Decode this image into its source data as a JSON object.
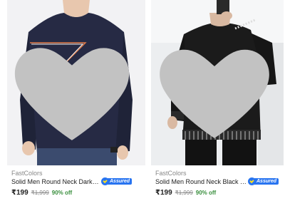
{
  "products": [
    {
      "brand": "FastColors",
      "title": "Solid Men Round Neck Dark Blue T-Shirt",
      "assured_label": "Assured",
      "price": "₹199",
      "mrp": "₹1,999",
      "discount": "90% off",
      "image_icon": "navy-tshirt-image",
      "wishlist_icon": "heart-icon"
    },
    {
      "brand": "FastColors",
      "title": "Solid Men Round Neck Black T-Shirt",
      "assured_label": "Assured",
      "price": "₹199",
      "mrp": "₹1,999",
      "discount": "90% off",
      "image_icon": "black-tshirt-image",
      "wishlist_icon": "heart-icon"
    }
  ],
  "colors": {
    "assured_blue": "#2874f0",
    "discount_green": "#388e3c",
    "heart_grey": "#c2c2c2",
    "muted_text": "#878787"
  }
}
